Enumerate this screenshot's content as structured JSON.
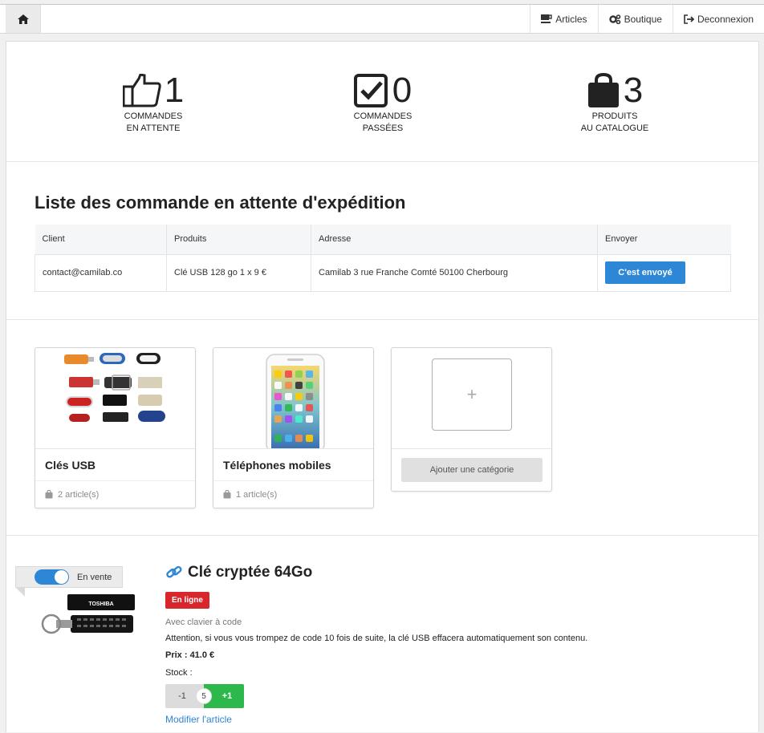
{
  "nav": {
    "articles": "Articles",
    "boutique": "Boutique",
    "logout": "Deconnexion"
  },
  "stats": [
    {
      "value": "1",
      "line1": "COMMANDES",
      "line2": "EN ATTENTE",
      "icon": "thumbs-up-icon"
    },
    {
      "value": "0",
      "line1": "COMMANDES",
      "line2": "PASSÉES",
      "icon": "checkbox-icon"
    },
    {
      "value": "3",
      "line1": "PRODUITS",
      "line2": "AU CATALOGUE",
      "icon": "shopping-bag-icon"
    }
  ],
  "orders": {
    "title": "Liste des commande en attente d'expédition",
    "headers": [
      "Client",
      "Produits",
      "Adresse",
      "Envoyer"
    ],
    "rows": [
      {
        "client": "contact@camilab.co",
        "products": "Clé USB 128 go 1 x 9 €",
        "address": "Camilab 3 rue Franche Comté 50100 Cherbourg",
        "action": "C'est envoyé"
      }
    ]
  },
  "categories": [
    {
      "name": "Clés USB",
      "count": "2 article(s)"
    },
    {
      "name": "Téléphones mobiles",
      "count": "1 article(s)"
    }
  ],
  "add_category": "Ajouter une catégorie",
  "product": {
    "on_sale_label": "En vente",
    "title": "Clé cryptée 64Go",
    "status": "En ligne",
    "subtitle": "Avec clavier à code",
    "description": "Attention, si vous vous trompez de code 10 fois de suite, la clé USB effacera automatiquement son contenu.",
    "price": "Prix : 41.0 €",
    "stock_label": "Stock :",
    "stock_minus": "-1",
    "stock_value": "5",
    "stock_plus": "+1",
    "edit": "Modifier l'article",
    "usb_brand": "TOSHIBA"
  },
  "colors": {
    "accent": "#2e86d6",
    "danger": "#d9252c",
    "success": "#2db84c"
  }
}
